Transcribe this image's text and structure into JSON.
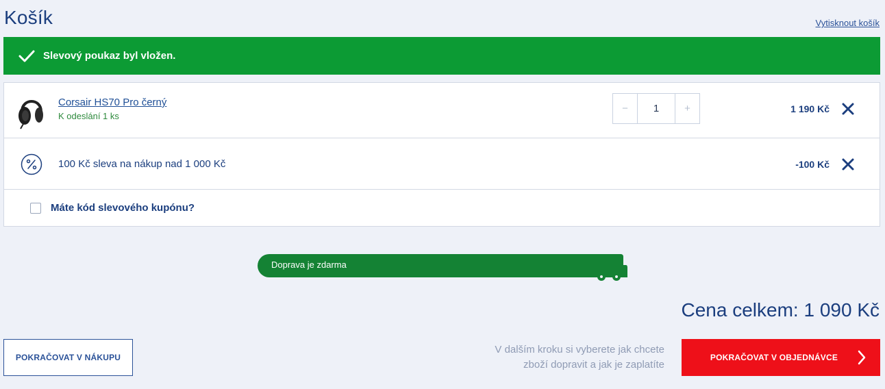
{
  "header": {
    "title": "Košík",
    "print_link": "Vytisknout košík"
  },
  "alert": {
    "message": "Slevový poukaz byl vložen.",
    "icon": "checkmark-icon",
    "color": "#0c9b34"
  },
  "cart": {
    "item": {
      "name": "Corsair HS70 Pro černý",
      "availability": "K odeslání 1 ks",
      "quantity": "1",
      "decrease_label": "−",
      "increase_label": "+",
      "price": "1 190 Kč",
      "image_icon": "headset-icon"
    },
    "discount": {
      "label": "100 Kč sleva na nákup nad 1 000 Kč",
      "price": "-100 Kč",
      "icon": "percent-icon"
    },
    "coupon": {
      "label": "Máte kód slevového kupónu?",
      "checked": false
    }
  },
  "shipping": {
    "label": "Doprava je zdarma",
    "progress": 1.0,
    "color": "#148234"
  },
  "summary": {
    "total": "Cena celkem: 1 090 Kč"
  },
  "footer": {
    "continue_shopping": "POKRAČOVAT V NÁKUPU",
    "hint_line1": "V dalším kroku si vyberete jak chcete",
    "hint_line2": "zboží dopravit a jak je zaplatíte",
    "continue_order": "POKRAČOVAT V OBJEDNÁVCE",
    "order_color": "#ee1019"
  }
}
